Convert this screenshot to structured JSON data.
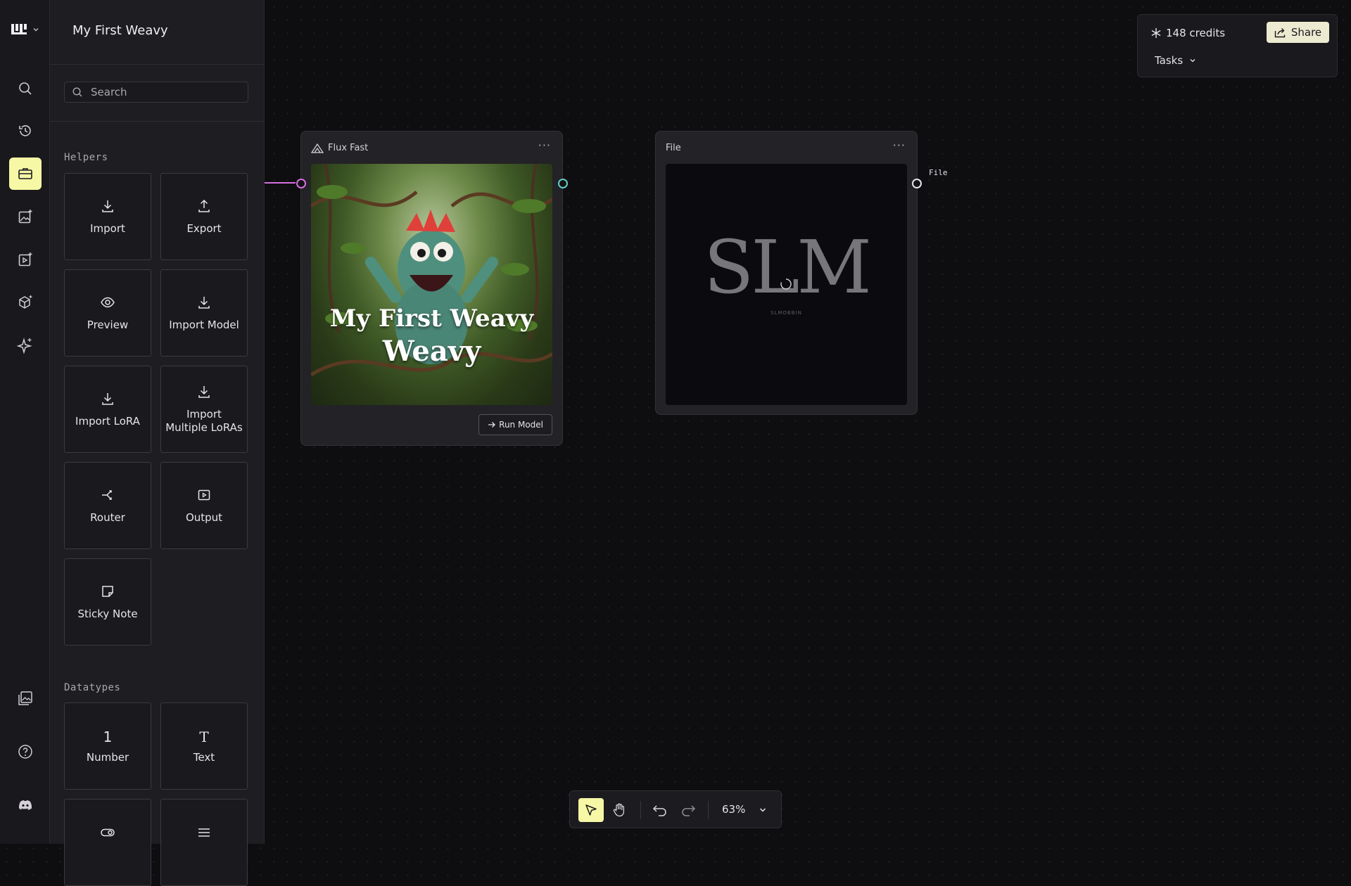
{
  "app": {
    "project_title": "My First Weavy"
  },
  "search": {
    "placeholder": "Search"
  },
  "sections": {
    "helpers": "Helpers",
    "datatypes": "Datatypes"
  },
  "helpers": [
    {
      "label": "Import",
      "icon": "download-icon"
    },
    {
      "label": "Export",
      "icon": "upload-icon"
    },
    {
      "label": "Preview",
      "icon": "eye-icon"
    },
    {
      "label": "Import Model",
      "icon": "download-icon"
    },
    {
      "label": "Import LoRA",
      "icon": "download-icon"
    },
    {
      "label": "Import Multiple LoRAs",
      "icon": "download-icon"
    },
    {
      "label": "Router",
      "icon": "router-icon"
    },
    {
      "label": "Output",
      "icon": "output-icon"
    },
    {
      "label": "Sticky Note",
      "icon": "sticky-note-icon"
    }
  ],
  "datatypes": [
    {
      "label": "Number",
      "icon": "number-icon",
      "glyph": "1"
    },
    {
      "label": "Text",
      "icon": "text-icon",
      "glyph": "T"
    },
    {
      "label": "",
      "icon": "toggle-icon"
    },
    {
      "label": "",
      "icon": "menu-lines-icon"
    }
  ],
  "nodes": {
    "flux": {
      "title": "Flux Fast",
      "image_caption_line1": "My First Weavy",
      "image_caption_line2": "Weavy",
      "run_label": "Run Model"
    },
    "file": {
      "title": "File",
      "output_label": "File",
      "logo_text": "SLM",
      "logo_subtext": "SLMOBBIN"
    }
  },
  "topright": {
    "credits": "148 credits",
    "share_label": "Share",
    "tasks_label": "Tasks"
  },
  "toolbar": {
    "zoom": "63%"
  },
  "colors": {
    "accent": "#f7f8a6",
    "edge": "#d86fe0",
    "port_teal": "#5fd0c4"
  }
}
